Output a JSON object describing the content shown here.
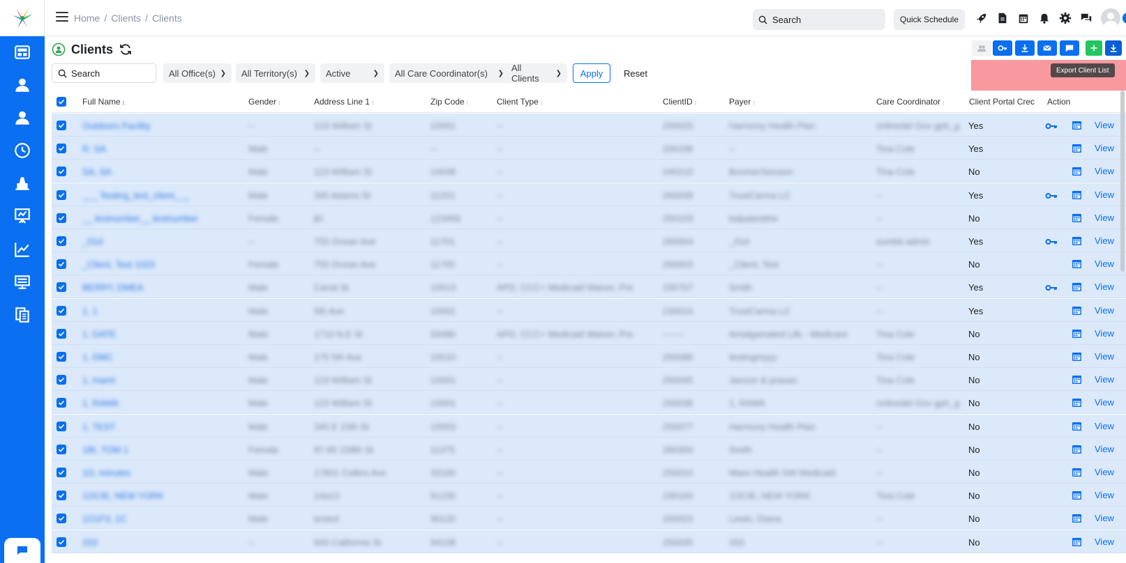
{
  "colors": {
    "primary": "#0a6ff0",
    "row_selected": "#dbe9fb",
    "add_green": "#22c55e",
    "highlight": "#f04650"
  },
  "sidebar": {
    "logo": "brand-logo-icon",
    "items": [
      {
        "icon": "dashboard-icon"
      },
      {
        "icon": "caregiver-icon"
      },
      {
        "icon": "client-icon"
      },
      {
        "icon": "clock-icon"
      },
      {
        "icon": "billing-icon"
      },
      {
        "icon": "presentation-icon"
      },
      {
        "icon": "analytics-chart-icon"
      },
      {
        "icon": "monitor-icon"
      },
      {
        "icon": "documents-icon"
      }
    ]
  },
  "header": {
    "breadcrumb": [
      "Home",
      "Clients",
      "Clients"
    ],
    "search_placeholder": "Search",
    "quick_schedule": "Quick Schedule",
    "icons": [
      "rocket-icon",
      "document-icon",
      "calendar-icon",
      "bell-icon",
      "gear-icon",
      "chat-icon",
      "bookmark-icon",
      "help-icon"
    ]
  },
  "page": {
    "title": "Clients",
    "tooltip": "Export Client List",
    "action_icons": [
      "group-icon",
      "key-icon",
      "download-icon",
      "mail-icon",
      "message-icon",
      "add-icon",
      "export-icon"
    ]
  },
  "filters": {
    "search_placeholder": "Search",
    "office": "All Office(s)",
    "territory": "All Territory(s)",
    "status": "Active",
    "coordinator": "All Care Coordinator(s)",
    "clients": "All Clients",
    "apply": "Apply",
    "reset": "Reset"
  },
  "table": {
    "columns": {
      "full_name": "Full Name",
      "gender": "Gender",
      "address": "Address Line 1",
      "zip": "Zip Code",
      "client_type": "Client Type",
      "client_id": "ClientID",
      "payer": "Payer",
      "care_coordinator": "Care Coordinator",
      "portal": "Client Portal Crec",
      "action": "Action"
    },
    "view_label": "View",
    "rows": [
      {
        "name": "Outdoors Facility",
        "gender": "--",
        "address": "123 William St",
        "zip": "10001",
        "type": "--",
        "id": "250025",
        "payer": "Harmony Health Plan",
        "coord": "onlinedel Gov gph_g",
        "portal": "Yes",
        "key": true
      },
      {
        "name": "R. SA",
        "gender": "Male",
        "address": "--",
        "zip": "--",
        "type": "--",
        "id": "200198",
        "payer": "--",
        "coord": "Tina Cole",
        "portal": "Yes",
        "key": false
      },
      {
        "name": "SA, SA",
        "gender": "Male",
        "address": "123 William St",
        "zip": "10038",
        "type": "--",
        "id": "240210",
        "payer": "BoomerSession",
        "coord": "Tina Cole",
        "portal": "No",
        "key": false
      },
      {
        "name": "___ Testing_test_client___",
        "gender": "Male",
        "address": "345 Adams St",
        "zip": "11201",
        "type": "--",
        "id": "260039",
        "payer": "TrustCarma LC",
        "coord": "--",
        "portal": "Yes",
        "key": true
      },
      {
        "name": "__ testnumber__ testnumber",
        "gender": "Female",
        "address": "jkl",
        "zip": "123456",
        "type": "--",
        "id": "250103",
        "payer": "kalpatestthe",
        "coord": "--",
        "portal": "No",
        "key": false
      },
      {
        "name": "_01d",
        "gender": "--",
        "address": "755 Ocean Ave",
        "zip": "11701",
        "type": "--",
        "id": "260004",
        "payer": "_01d",
        "coord": "sumbit admin",
        "portal": "Yes",
        "key": true
      },
      {
        "name": "_Client, Test 1023",
        "gender": "Female",
        "address": "755 Ocean Ave",
        "zip": "11705",
        "type": "--",
        "id": "260003",
        "payer": "_Client, Test",
        "coord": "--",
        "portal": "No",
        "key": false
      },
      {
        "name": "BERRY, DMEA",
        "gender": "Male",
        "address": "Canal St",
        "zip": "10013",
        "type": "APD, CCC+ Medicaid Waiver, Pre",
        "id": "230707",
        "payer": "Smith",
        "coord": "--",
        "portal": "Yes",
        "key": true
      },
      {
        "name": "1, 1",
        "gender": "Male",
        "address": "5th Ave",
        "zip": "10001",
        "type": "--",
        "id": "230016",
        "payer": "TrustCarma LC",
        "coord": "--",
        "portal": "Yes",
        "key": false
      },
      {
        "name": "1, DATE",
        "gender": "Male",
        "address": "1710 N.E St",
        "zip": "33480",
        "type": "APD, CCC+ Medicaid Waiver, Pre",
        "id": "-------",
        "payer": "Amalgamated Life - Medicare",
        "coord": "Tina Cole",
        "portal": "No",
        "key": false
      },
      {
        "name": "1, DMC",
        "gender": "Male",
        "address": "175 5th Ave",
        "zip": "10010",
        "type": "--",
        "id": "250088",
        "payer": "testingmyyy",
        "coord": "Tina Cole",
        "portal": "No",
        "key": false
      },
      {
        "name": "1, mamt",
        "gender": "Male",
        "address": "123 William St",
        "zip": "10001",
        "type": "--",
        "id": "250045",
        "payer": "Janson & prasan",
        "coord": "Tina Cole",
        "portal": "No",
        "key": false
      },
      {
        "name": "1, RAMA",
        "gender": "Male",
        "address": "123 William St",
        "zip": "10001",
        "type": "--",
        "id": "250038",
        "payer": "1, RAMA",
        "coord": "onlinedel Gov gph_g",
        "portal": "No",
        "key": false
      },
      {
        "name": "1, TEST",
        "gender": "Male",
        "address": "345 E 15th St",
        "zip": "10003",
        "type": "--",
        "id": "250077",
        "payer": "Harmony Health Plan",
        "coord": "--",
        "portal": "No",
        "key": false
      },
      {
        "name": "1BI, TOM 1",
        "gender": "Female",
        "address": "87-90 158th St",
        "zip": "11375",
        "type": "--",
        "id": "260300",
        "payer": "Smith",
        "coord": "--",
        "portal": "No",
        "key": false
      },
      {
        "name": "1D, minutes",
        "gender": "Male",
        "address": "17801 Collins Ave",
        "zip": "33160",
        "type": "--",
        "id": "250010",
        "payer": "Mass Health SW Medicaid",
        "coord": "--",
        "portal": "No",
        "key": false
      },
      {
        "name": "1OCIE, NEW YORK",
        "gender": "Male",
        "address": "14a13",
        "zip": "91230",
        "type": "--",
        "id": "230100",
        "payer": "1OCIE, NEW YORK",
        "coord": "Tina Cole",
        "portal": "No",
        "key": false
      },
      {
        "name": "1O1F3, 1C",
        "gender": "Male",
        "address": "tested",
        "zip": "90120",
        "type": "--",
        "id": "250023",
        "payer": "Lewis, Diana",
        "coord": "--",
        "portal": "No",
        "key": false
      },
      {
        "name": "333",
        "gender": "--",
        "address": "600 California St",
        "zip": "94108",
        "type": "--",
        "id": "250035",
        "payer": "333",
        "coord": "--",
        "portal": "No",
        "key": false
      }
    ]
  }
}
